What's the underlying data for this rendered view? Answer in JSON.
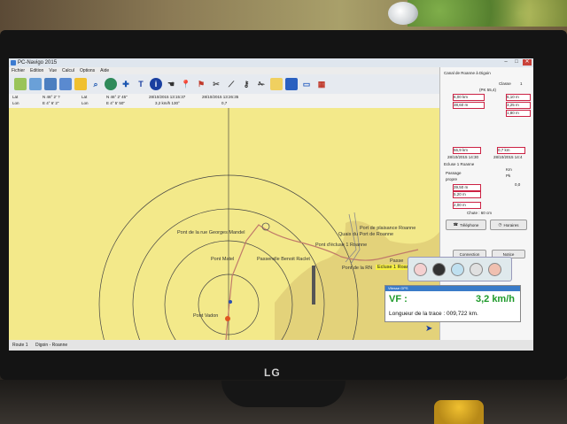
{
  "app": {
    "title": "PC-Navigo 2015",
    "menu": [
      "Fichier",
      "Edition",
      "Vue",
      "Calcul",
      "Options",
      "Aide"
    ],
    "window_buttons": [
      "–",
      "□",
      "✕"
    ]
  },
  "coords": {
    "row1": [
      "Lat",
      "N 46° 2' ?",
      "Lat",
      "N 46° 2' 45\"",
      "28/10/2015 13:15:37",
      "28/10/2015 13:26:35"
    ],
    "row2": [
      "Lon",
      "E 4° 6' 2\"",
      "Lon",
      "E 4° 5' 50\"",
      "3,2 km/h  130°",
      "0,7"
    ]
  },
  "map_labels": {
    "pont_mandel": "Pont de la rue Georges Mandel",
    "pont_matel": "Pont Matel",
    "passerelle": "Passerelle Benoit Raclet",
    "pont_vadon": "Pont Vadon",
    "port_plaisance": "Port de plaisance Roanne",
    "quais_port": "Quais du Port de Roanne",
    "pont_ecluse": "Pont d'écluse 1 Roanne",
    "pont_rn": "Pont de la RN",
    "passerelle2": "Passe",
    "ecluse_highlight": "Ecluse 1 Roanne"
  },
  "panel": {
    "canal": "Canal de Roanne à Digoin",
    "classe_label": "Classe",
    "classe_value": "1",
    "pk": "(PK 55,4)",
    "values_left": [
      "6,00 km",
      "38,60 m"
    ],
    "values_right": [
      "5,10 m",
      "3,25 m",
      "1,80 m"
    ],
    "from": "56,9 km",
    "to": "0,7 km",
    "time_from": "28/10/2015 14:30",
    "time_to": "28/10/2015 14:4",
    "ecluse_title": "Ecluse 1 Roanne",
    "km_label": "Km",
    "passage": "Passage",
    "propre": "propre",
    "pk_label": "Pk",
    "pk_value": "0,0",
    "dims": [
      "39,50 m",
      "5,20 m",
      "2,00 m"
    ],
    "chute": "Chute : 60 cm",
    "btn_tel": "Téléphone",
    "btn_horaires": "Horaires",
    "btn_connection": "Connection",
    "btn_notice": "Notice"
  },
  "speed": {
    "header": "Vitesse GPS",
    "label": "VF :",
    "value": "3,2 km/h",
    "trace": "Longueur de la trace : 009,722 km."
  },
  "status": {
    "left": "Route 1",
    "right": "Digoin - Roanne"
  },
  "device": {
    "brand": "LG"
  }
}
